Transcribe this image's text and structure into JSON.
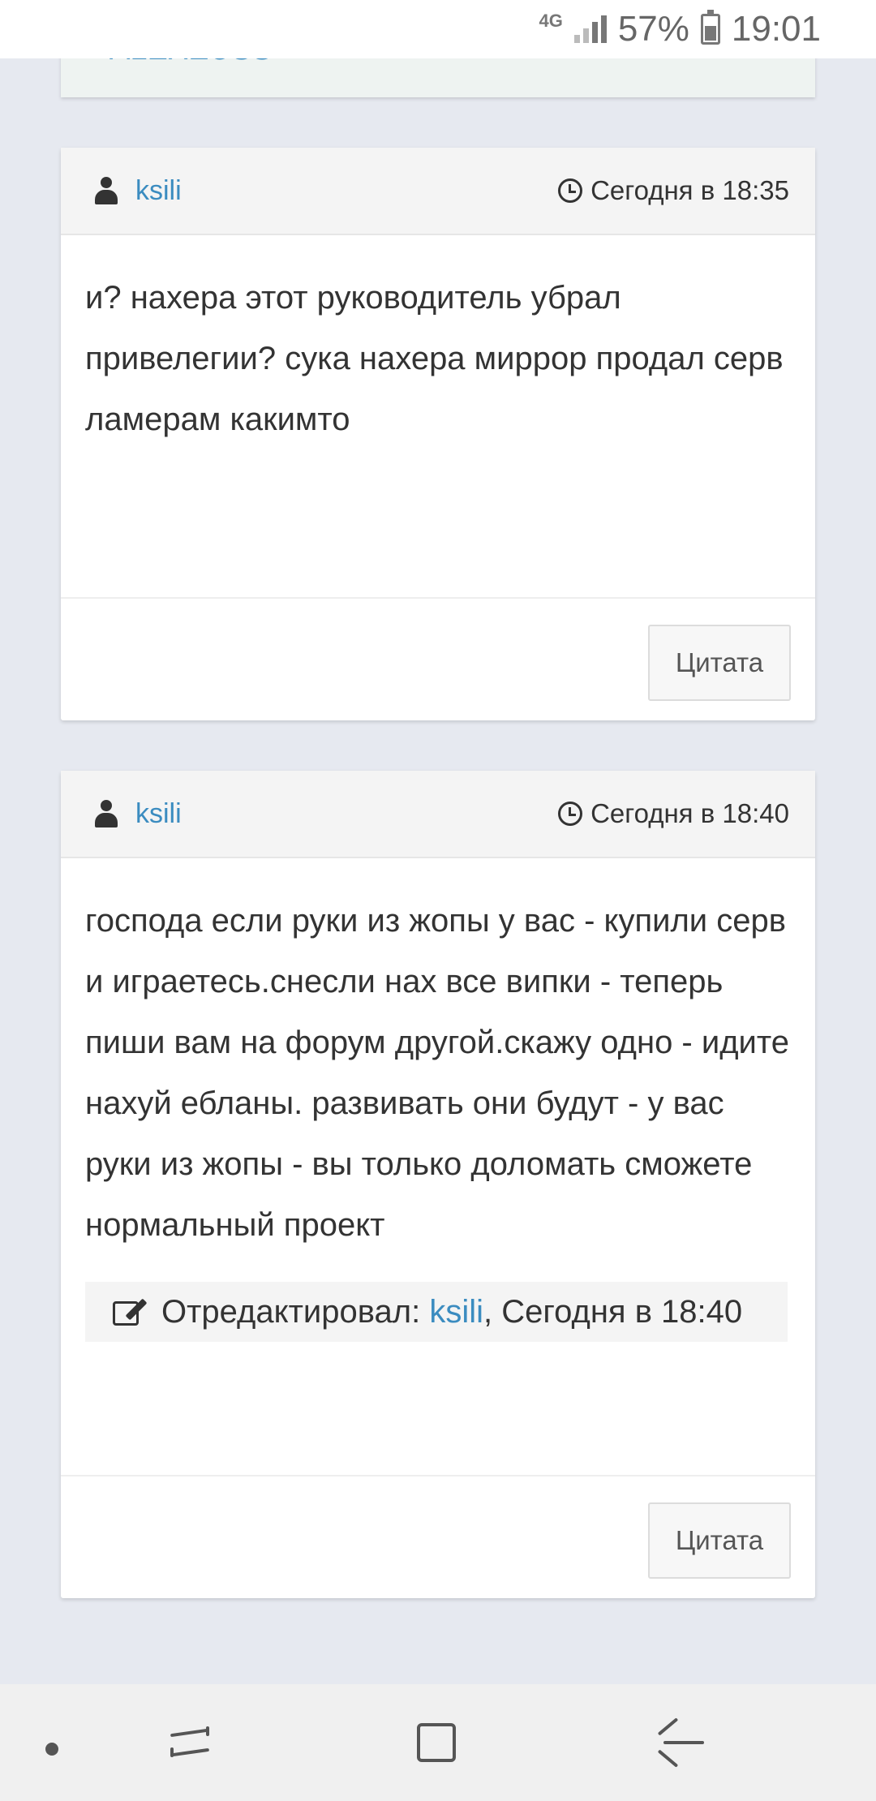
{
  "status_bar": {
    "network": "4G",
    "battery": "57%",
    "time": "19:01"
  },
  "prev_card": {
    "partial_link": "ALEXEUSS"
  },
  "posts": [
    {
      "author": "ksili",
      "time": "Сегодня в 18:35",
      "body": "и? нахера этот руководитель убрал привелегии? сука нахера миррор продал серв ламерам какимто",
      "quote_label": "Цитата"
    },
    {
      "author": "ksili",
      "time": "Сегодня в 18:40",
      "body": "господа если руки из жопы у вас - купили серв и играетесь.снесли нах все випки - теперь пиши вам на форум другой.скажу одно - идите нахуй ебланы. развивать они будут - у вас руки из жопы - вы только доломать сможете нормальный проект",
      "edit": {
        "prefix": "Отредактировал:",
        "editor": "ksili",
        "suffix": ", Сегодня в 18:40"
      },
      "quote_label": "Цитата"
    }
  ]
}
